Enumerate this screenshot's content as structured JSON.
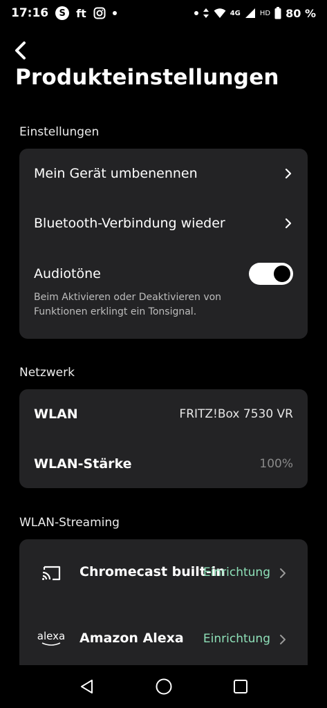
{
  "status_bar": {
    "time": "17:16",
    "app_icons": [
      "S",
      "ft"
    ],
    "network": "4G",
    "hd": "HD",
    "battery": "80 %"
  },
  "page": {
    "title": "Produkteinstellungen"
  },
  "settings": {
    "section_title": "Einstellungen",
    "rename_label": "Mein Gerät umbenennen",
    "bluetooth_label": "Bluetooth-Verbindung wieder",
    "audio_label": "Audiotöne",
    "audio_enabled": true,
    "audio_desc": "Beim Aktivieren oder Deaktivieren von Funktionen erklingt ein Tonsignal."
  },
  "network": {
    "section_title": "Netzwerk",
    "wlan_label": "WLAN",
    "wlan_value": "FRITZ!Box 7530 VR",
    "strength_label": "WLAN-Stärke",
    "strength_value": "100%"
  },
  "streaming": {
    "section_title": "WLAN-Streaming",
    "chromecast_label": "Chromecast built-in",
    "chromecast_action": "Einrichtung",
    "alexa_logo": "alexa",
    "alexa_label": "Amazon Alexa",
    "alexa_action": "Einrichtung"
  },
  "colors": {
    "background": "#000000",
    "card": "#232325",
    "accent_setup": "#8ee0b8",
    "muted": "#8a8a8a"
  }
}
